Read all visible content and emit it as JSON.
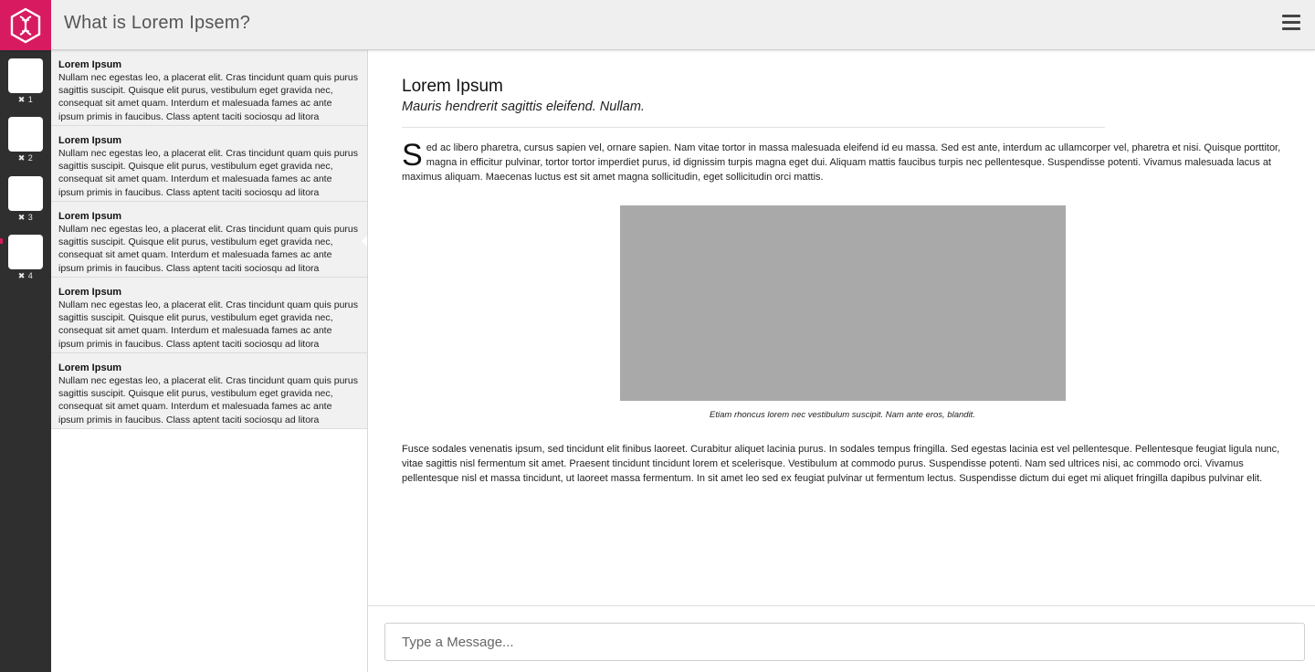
{
  "app": {
    "title": "What is Lorem Ipsem?"
  },
  "colors": {
    "brand": "#d81b60",
    "rail": "#2f2f2f",
    "header": "#efefef",
    "image_placeholder": "#a9a9a9"
  },
  "icons": {
    "logo": "dna-hexagon-icon",
    "menu": "hamburger-menu-icon",
    "rail_badge": "close-x-icon"
  },
  "rail": {
    "items": [
      {
        "count": "✖ 1"
      },
      {
        "count": "✖ 2"
      },
      {
        "count": "✖ 3"
      },
      {
        "count": "✖ 4"
      }
    ]
  },
  "messages": [
    {
      "title": "Lorem Ipsum",
      "body": "Nullam nec egestas leo, a placerat elit. Cras tincidunt quam quis purus sagittis suscipit. Quisque elit purus, vestibulum eget gravida nec, consequat sit amet quam. Interdum et malesuada fames ac ante ipsum primis in faucibus. Class aptent taciti sociosqu ad litora"
    },
    {
      "title": "Lorem Ipsum",
      "body": "Nullam nec egestas leo, a placerat elit. Cras tincidunt quam quis purus sagittis suscipit. Quisque elit purus, vestibulum eget gravida nec, consequat sit amet quam. Interdum et malesuada fames ac ante ipsum primis in faucibus. Class aptent taciti sociosqu ad litora"
    },
    {
      "title": "Lorem Ipsum",
      "body": "Nullam nec egestas leo, a placerat elit. Cras tincidunt quam quis purus sagittis suscipit. Quisque elit purus, vestibulum eget gravida nec, consequat sit amet quam. Interdum et malesuada fames ac ante ipsum primis in faucibus. Class aptent taciti sociosqu ad litora"
    },
    {
      "title": "Lorem Ipsum",
      "body": "Nullam nec egestas leo, a placerat elit. Cras tincidunt quam quis purus sagittis suscipit. Quisque elit purus, vestibulum eget gravida nec, consequat sit amet quam. Interdum et malesuada fames ac ante ipsum primis in faucibus. Class aptent taciti sociosqu ad litora"
    },
    {
      "title": "Lorem Ipsum",
      "body": "Nullam nec egestas leo, a placerat elit. Cras tincidunt quam quis purus sagittis suscipit. Quisque elit purus, vestibulum eget gravida nec, consequat sit amet quam. Interdum et malesuada fames ac ante ipsum primis in faucibus. Class aptent taciti sociosqu ad litora"
    }
  ],
  "article": {
    "title": "Lorem Ipsum",
    "subtitle": "Mauris hendrerit sagittis eleifend. Nullam.",
    "dropcap": "S",
    "para1": "ed ac libero pharetra, cursus sapien vel, ornare sapien. Nam vitae tortor in massa malesuada eleifend id eu massa. Sed est ante, interdum ac ullamcorper vel, pharetra et nisi. Quisque porttitor, magna in efficitur pulvinar, tortor tortor imperdiet purus, id dignissim turpis magna eget dui. Aliquam mattis faucibus turpis nec pellentesque. Suspendisse potenti. Vivamus malesuada lacus at maximus aliquam. Maecenas luctus est sit amet magna sollicitudin, eget sollicitudin orci mattis.",
    "caption": "Etiam rhoncus lorem nec vestibulum suscipit. Nam ante eros, blandit.",
    "para2": "Fusce sodales venenatis ipsum, sed tincidunt elit finibus laoreet. Curabitur aliquet lacinia purus. In sodales tempus fringilla. Sed egestas lacinia est vel pellentesque. Pellentesque feugiat ligula nunc, vitae sagittis nisl fermentum sit amet. Praesent tincidunt tincidunt lorem et scelerisque. Vestibulum at commodo purus. Suspendisse potenti. Nam sed ultrices nisi, ac commodo orci. Vivamus pellentesque nisl et massa tincidunt, ut laoreet massa fermentum. In sit amet leo sed ex feugiat pulvinar ut fermentum lectus. Suspendisse dictum dui eget mi aliquet fringilla dapibus pulvinar elit."
  },
  "composer": {
    "placeholder": "Type a Message..."
  }
}
